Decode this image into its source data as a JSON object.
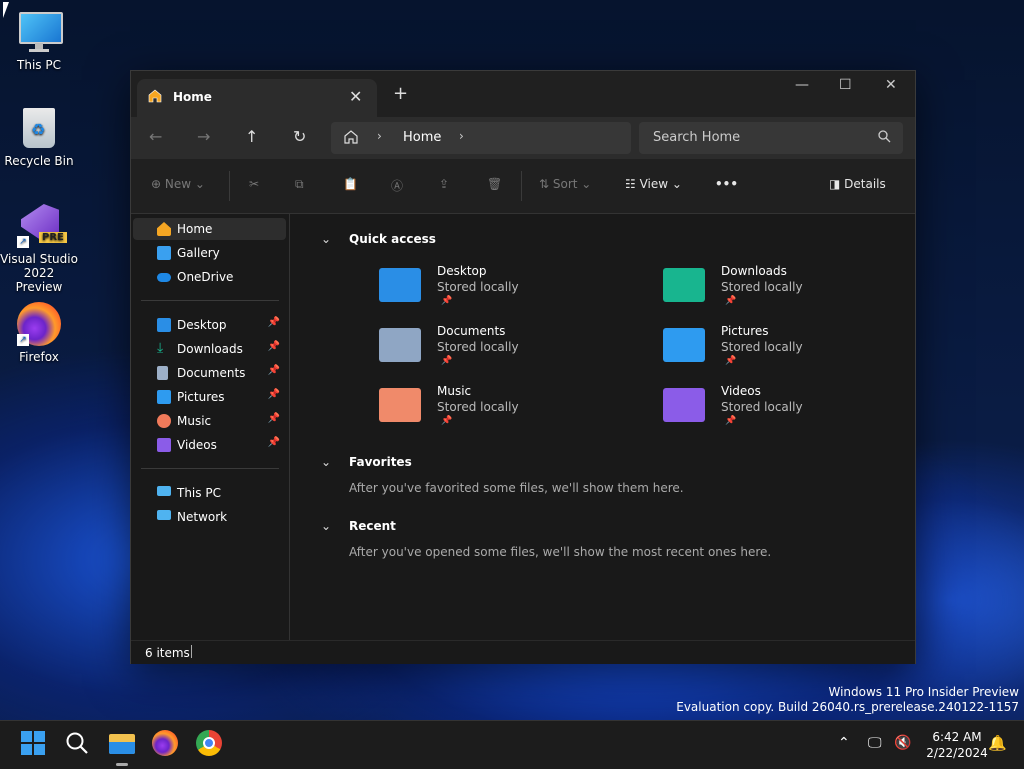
{
  "desktop": {
    "icons": [
      {
        "label": "This PC"
      },
      {
        "label": "Recycle Bin"
      },
      {
        "label": "Visual Studio 2022 Preview",
        "badge": "PRE"
      },
      {
        "label": "Firefox"
      }
    ]
  },
  "explorer": {
    "tab_title": "Home",
    "address": {
      "crumbs": [
        "Home"
      ]
    },
    "search_placeholder": "Search Home",
    "toolbar": {
      "new": "New",
      "sort": "Sort",
      "view": "View",
      "more": "•••",
      "details": "Details"
    },
    "sidebar": {
      "group1": [
        {
          "label": "Home",
          "selected": true,
          "icon": "home-icon"
        },
        {
          "label": "Gallery",
          "icon": "gallery-icon"
        },
        {
          "label": "OneDrive",
          "icon": "onedrive-icon"
        }
      ],
      "group2": [
        {
          "label": "Desktop",
          "icon": "desktop-folder-icon"
        },
        {
          "label": "Downloads",
          "icon": "downloads-icon"
        },
        {
          "label": "Documents",
          "icon": "documents-icon"
        },
        {
          "label": "Pictures",
          "icon": "pictures-icon"
        },
        {
          "label": "Music",
          "icon": "music-icon"
        },
        {
          "label": "Videos",
          "icon": "videos-icon"
        }
      ],
      "group3": [
        {
          "label": "This PC",
          "icon": "this-pc-icon"
        },
        {
          "label": "Network",
          "icon": "network-icon"
        }
      ]
    },
    "quick_access": {
      "title": "Quick access",
      "items": [
        {
          "name": "Desktop",
          "sub": "Stored locally",
          "color": "#2a8ee6"
        },
        {
          "name": "Downloads",
          "sub": "Stored locally",
          "color": "#18b58f"
        },
        {
          "name": "Documents",
          "sub": "Stored locally",
          "color": "#8fa6c4"
        },
        {
          "name": "Pictures",
          "sub": "Stored locally",
          "color": "#2e9bf0"
        },
        {
          "name": "Music",
          "sub": "Stored locally",
          "color": "#f08a6a"
        },
        {
          "name": "Videos",
          "sub": "Stored locally",
          "color": "#8b5ce8"
        }
      ]
    },
    "favorites": {
      "title": "Favorites",
      "empty": "After you've favorited some files, we'll show them here."
    },
    "recent": {
      "title": "Recent",
      "empty": "After you've opened some files, we'll show the most recent ones here."
    },
    "status": "6 items"
  },
  "watermark": {
    "line1": "Windows 11 Pro Insider Preview",
    "line2": "Evaluation copy. Build 26040.rs_prerelease.240122-1157"
  },
  "taskbar": {
    "time": "6:42 AM",
    "date": "2/22/2024"
  }
}
